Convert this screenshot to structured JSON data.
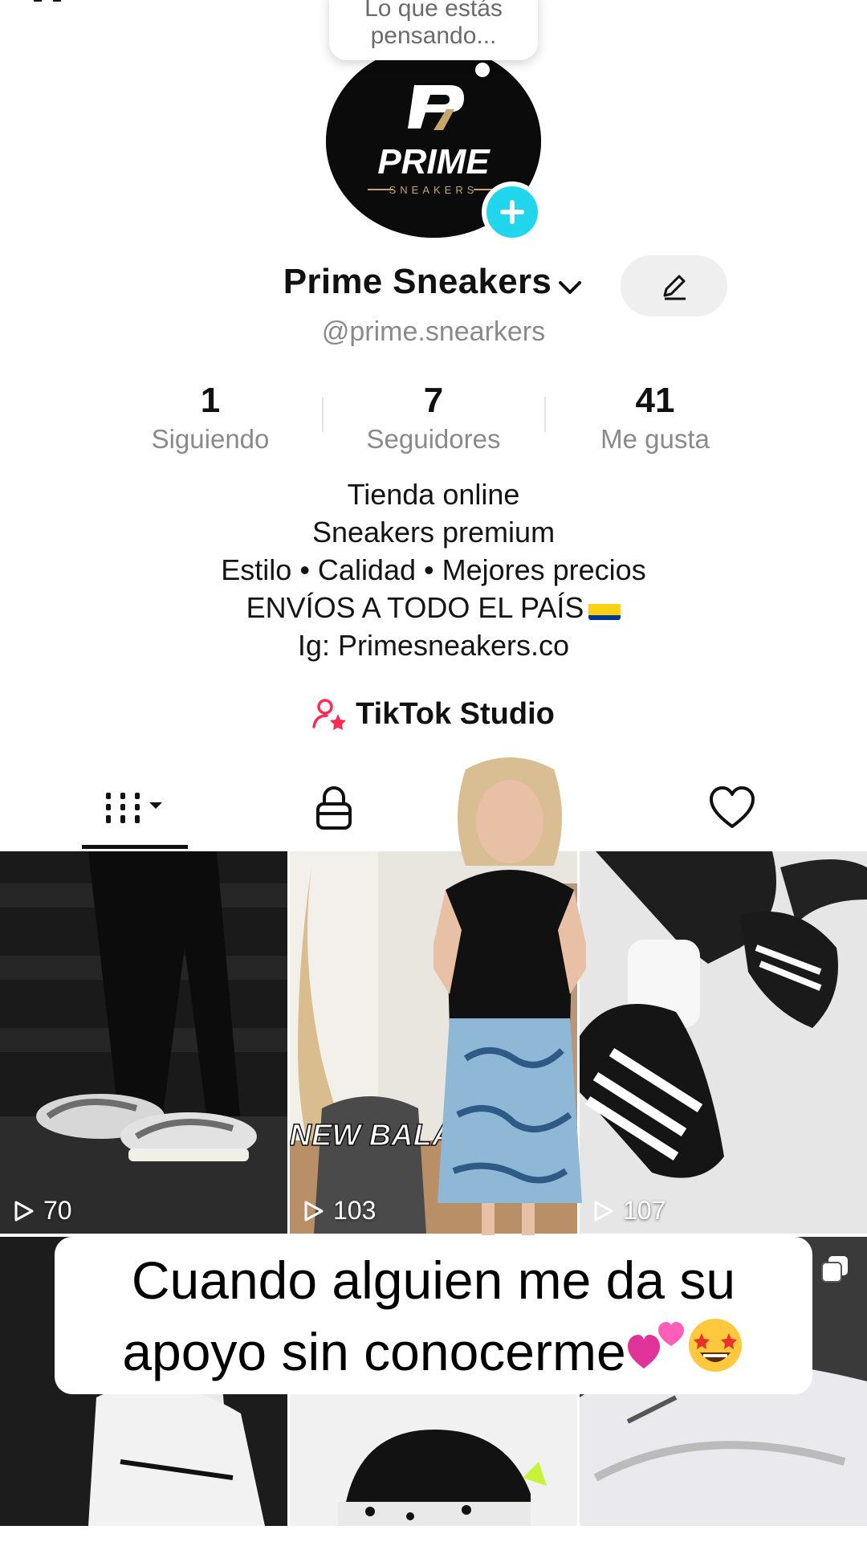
{
  "bubble": {
    "text": "Lo que estás pensando..."
  },
  "profile": {
    "display_name": "Prime Sneakers",
    "handle": "@prime.snearkers",
    "avatar_logo": {
      "title": "PRIME",
      "subtitle": "SNEAKERS"
    }
  },
  "stats": [
    {
      "value": "1",
      "label": "Siguiendo"
    },
    {
      "value": "7",
      "label": "Seguidores"
    },
    {
      "value": "41",
      "label": "Me gusta"
    }
  ],
  "bio": {
    "lines": [
      "Tienda online",
      "Sneakers premium",
      "Estilo • Calidad • Mejores precios",
      "ENVÍOS A TODO EL PAÍS",
      "Ig: Primesneakers.co"
    ],
    "flag": "colombia-flag"
  },
  "studio": {
    "label": "TikTok Studio"
  },
  "tabs": [
    {
      "icon": "grid-icon",
      "active": true
    },
    {
      "icon": "lock-icon",
      "active": false
    },
    {
      "icon": "bookmark-icon",
      "active": false
    },
    {
      "icon": "heart-icon",
      "active": false
    }
  ],
  "videos": [
    {
      "views": "70"
    },
    {
      "views": "103",
      "overlay_text": "NEW BALANCE 530"
    },
    {
      "views": "107"
    }
  ],
  "caption": {
    "text": "Cuando alguien me da su apoyo sin conocerme",
    "emojis": [
      "two-hearts",
      "star-struck"
    ]
  },
  "colors": {
    "accent_cyan": "#20d5ec",
    "studio_pink": "#fe2c55",
    "text_gray": "#8a8a8a"
  }
}
